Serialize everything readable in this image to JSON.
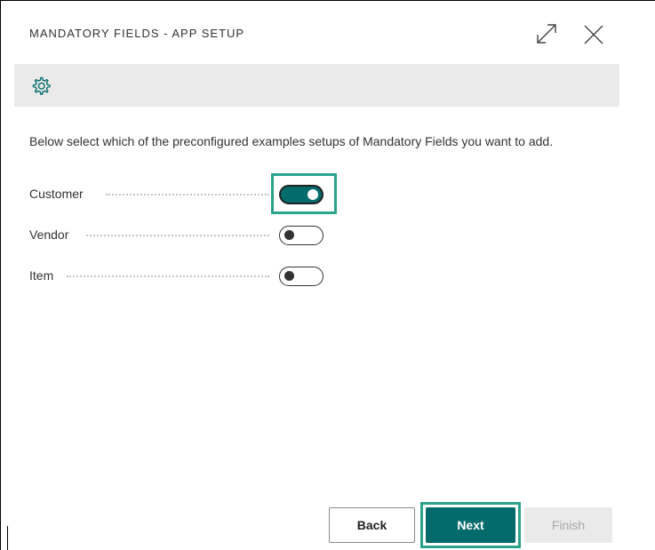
{
  "dialog": {
    "title": "MANDATORY FIELDS - APP SETUP",
    "expand_icon": "expand-icon",
    "close_icon": "close-icon"
  },
  "toolbar": {
    "settings_icon": "gear-icon"
  },
  "instructions": "Below select which of the preconfigured examples setups of Mandatory Fields you want to add.",
  "fields": [
    {
      "label": "Customer",
      "enabled": true
    },
    {
      "label": "Vendor",
      "enabled": false
    },
    {
      "label": "Item",
      "enabled": false
    }
  ],
  "buttons": {
    "back": "Back",
    "next": "Next",
    "finish": "Finish"
  },
  "colors": {
    "accent": "#046b6d",
    "highlight": "#2aa38a",
    "toolbar_bg": "#eaeaea"
  }
}
